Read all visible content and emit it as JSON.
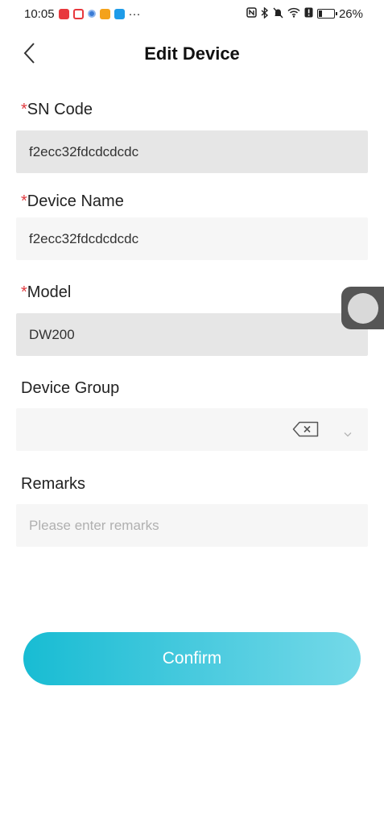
{
  "status_bar": {
    "time": "10:05",
    "more": "···",
    "battery_percent": "26%",
    "battery_level": 0.26
  },
  "header": {
    "title": "Edit Device"
  },
  "form": {
    "required_marker": "*",
    "sn_code": {
      "label": "SN Code",
      "value": "f2ecc32fdcdcdcdc"
    },
    "device_name": {
      "label": "Device Name",
      "value": "f2ecc32fdcdcdcdc"
    },
    "model": {
      "label": "Model",
      "value": "DW200"
    },
    "device_group": {
      "label": "Device Group",
      "value": ""
    },
    "remarks": {
      "label": "Remarks",
      "value": "",
      "placeholder": "Please enter remarks"
    }
  },
  "actions": {
    "confirm_label": "Confirm"
  },
  "colors": {
    "required": "#e0393e",
    "accent_start": "#18bcd3",
    "accent_end": "#74d9e8"
  }
}
